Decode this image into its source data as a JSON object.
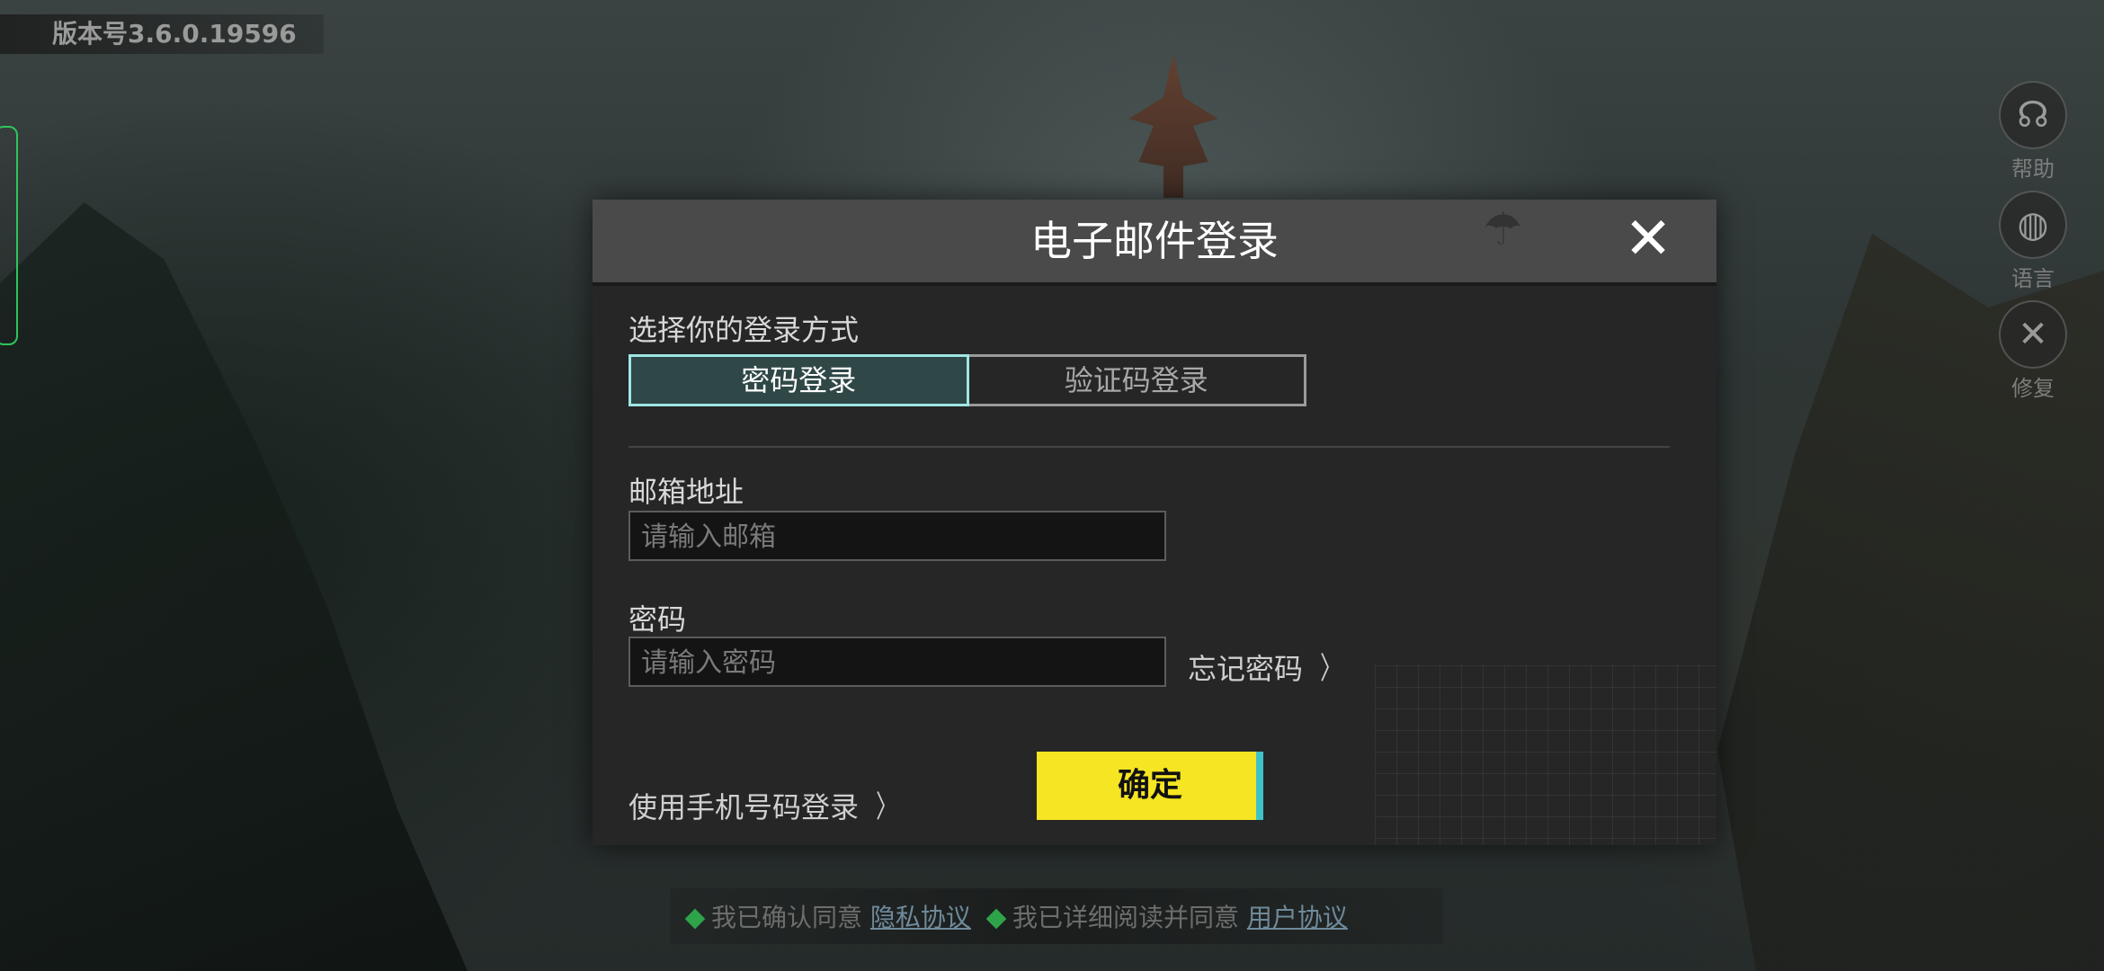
{
  "version": "版本号3.6.0.19596",
  "side_buttons": [
    {
      "label": "帮助",
      "icon": "headset-icon"
    },
    {
      "label": "语言",
      "icon": "globe-icon"
    },
    {
      "label": "修复",
      "icon": "wrench-icon"
    }
  ],
  "dialog": {
    "title": "电子邮件登录",
    "close_glyph": "✕",
    "method_label": "选择你的登录方式",
    "tabs": [
      "密码登录",
      "验证码登录"
    ],
    "email_label": "邮箱地址",
    "email_placeholder": "请输入邮箱",
    "password_label": "密码",
    "password_placeholder": "请输入密码",
    "forgot_password": "忘记密码",
    "phone_login": "使用手机号码登录",
    "confirm": "确定"
  },
  "agreements": {
    "privacy_prefix": "我已确认同意",
    "privacy_link": "隐私协议",
    "user_prefix": "我已详细阅读并同意",
    "user_link": "用户协议"
  },
  "colors": {
    "confirm_bg": "#f5e522",
    "active_tab_border": "#9fe6e3",
    "check_green": "#2fa34a"
  }
}
